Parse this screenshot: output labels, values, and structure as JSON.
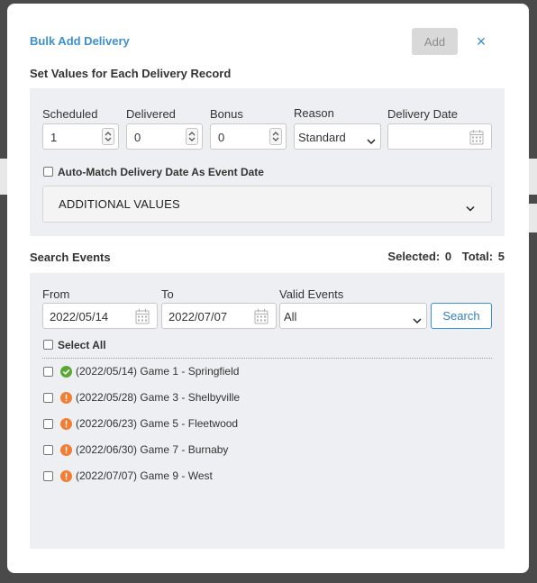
{
  "modal": {
    "title": "Bulk Add Delivery",
    "add_label": "Add",
    "close_glyph": "×"
  },
  "values_section": {
    "title": "Set Values for Each Delivery Record",
    "scheduled": {
      "label": "Scheduled",
      "value": "1"
    },
    "delivered": {
      "label": "Delivered",
      "value": "0"
    },
    "bonus": {
      "label": "Bonus",
      "value": "0"
    },
    "reason": {
      "label": "Reason",
      "value": "Standard"
    },
    "delivery_date": {
      "label": "Delivery Date",
      "value": ""
    },
    "auto_match_label": "Auto-Match Delivery Date As Event Date",
    "additional_values_label": "ADDITIONAL VALUES"
  },
  "search_section": {
    "title": "Search Events",
    "selected_label": "Selected:",
    "selected_count": "0",
    "total_label": "Total:",
    "total_count": "5",
    "from_label": "From",
    "from_value": "2022/05/14",
    "to_label": "To",
    "to_value": "2022/07/07",
    "valid_events_label": "Valid Events",
    "valid_events_value": "All",
    "search_label": "Search",
    "select_all_label": "Select All"
  },
  "events": [
    {
      "text": "(2022/05/14) Game 1 - Springfield",
      "status": "ok"
    },
    {
      "text": "(2022/05/28) Game 3 - Shelbyville",
      "status": "warn"
    },
    {
      "text": "(2022/06/23) Game 5 - Fleetwood",
      "status": "warn"
    },
    {
      "text": "(2022/06/30) Game 7 - Burnaby",
      "status": "warn"
    },
    {
      "text": "(2022/07/07) Game 9 - West",
      "status": "warn"
    }
  ],
  "icons": {
    "close": "close-icon",
    "spinner": "spinner-arrows-icon",
    "calendar": "calendar-icon",
    "chevron": "chevron-down-icon",
    "status_ok": "check-circle-icon",
    "status_warn": "warning-circle-icon"
  },
  "colors": {
    "accent": "#3c8fd0",
    "status_ok": "#5aa832",
    "status_warn": "#f07e35",
    "panel_bg": "#eeeff2"
  }
}
